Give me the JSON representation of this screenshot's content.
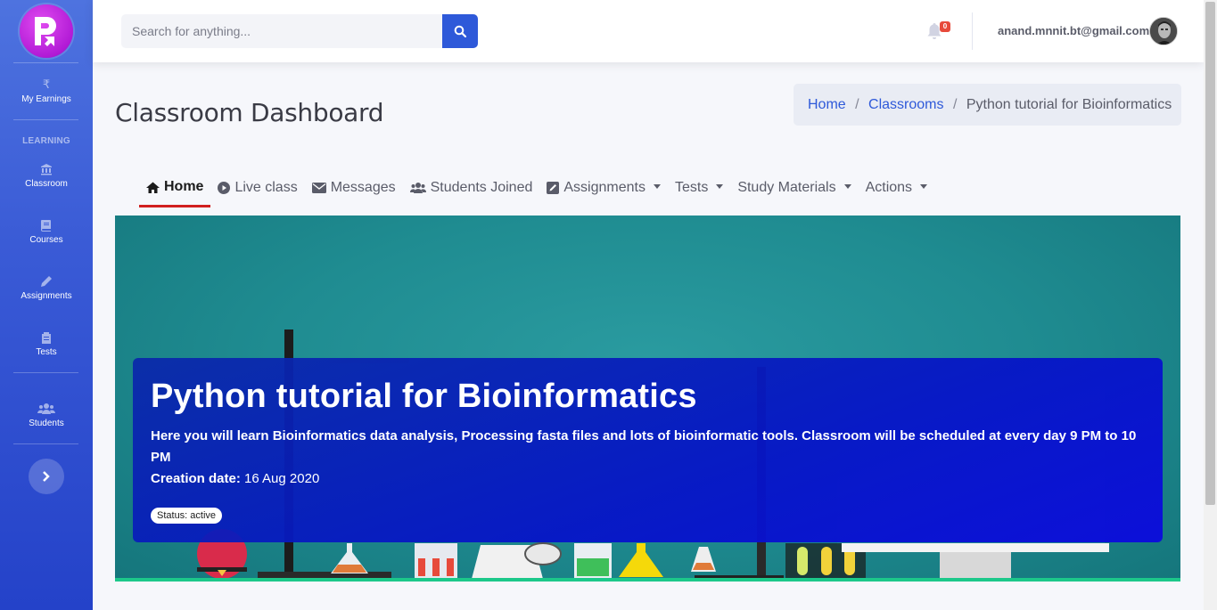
{
  "sidebar": {
    "items": [
      {
        "label": "My Earnings",
        "icon": "rupee-icon"
      },
      {
        "label": "Classroom",
        "icon": "bank-icon"
      },
      {
        "label": "Courses",
        "icon": "book-icon"
      },
      {
        "label": "Assignments",
        "icon": "pencil-icon"
      },
      {
        "label": "Tests",
        "icon": "clipboard-icon"
      },
      {
        "label": "Students",
        "icon": "users-icon"
      }
    ],
    "section_heading": "LEARNING",
    "toggle_icon": "chevron-right-icon"
  },
  "topbar": {
    "search_placeholder": "Search for anything...",
    "notification_count": "0",
    "user_email": "anand.mnnit.bt@gmail.com"
  },
  "page": {
    "title": "Classroom Dashboard"
  },
  "breadcrumb": {
    "home": "Home",
    "classrooms": "Classrooms",
    "current": "Python tutorial for Bioinformatics"
  },
  "tabs": [
    {
      "label": "Home",
      "icon": "home-icon",
      "active": true
    },
    {
      "label": "Live class",
      "icon": "play-circle-icon"
    },
    {
      "label": "Messages",
      "icon": "envelope-icon"
    },
    {
      "label": "Students Joined",
      "icon": "users-icon"
    },
    {
      "label": "Assignments",
      "icon": "edit-icon",
      "dropdown": true
    },
    {
      "label": "Tests",
      "dropdown": true
    },
    {
      "label": "Study Materials",
      "dropdown": true
    },
    {
      "label": "Actions",
      "dropdown": true
    }
  ],
  "classroom": {
    "title": "Python tutorial for Bioinformatics",
    "description": "Here you will learn Bioinformatics data analysis, Processing fasta files and lots of bioinformatic tools. Classroom will be scheduled at every day 9 PM to 10 PM",
    "creation_label": "Creation date:",
    "creation_date": "16 Aug 2020",
    "status": "Status: active"
  },
  "colors": {
    "sidebar": "#4e73df",
    "primary": "#2e59d9",
    "active_tab_underline": "#d11f1f",
    "banner_bg": "#1f8c91",
    "card_bg": "#0a1fc8",
    "banner_border": "#1cc88a"
  }
}
